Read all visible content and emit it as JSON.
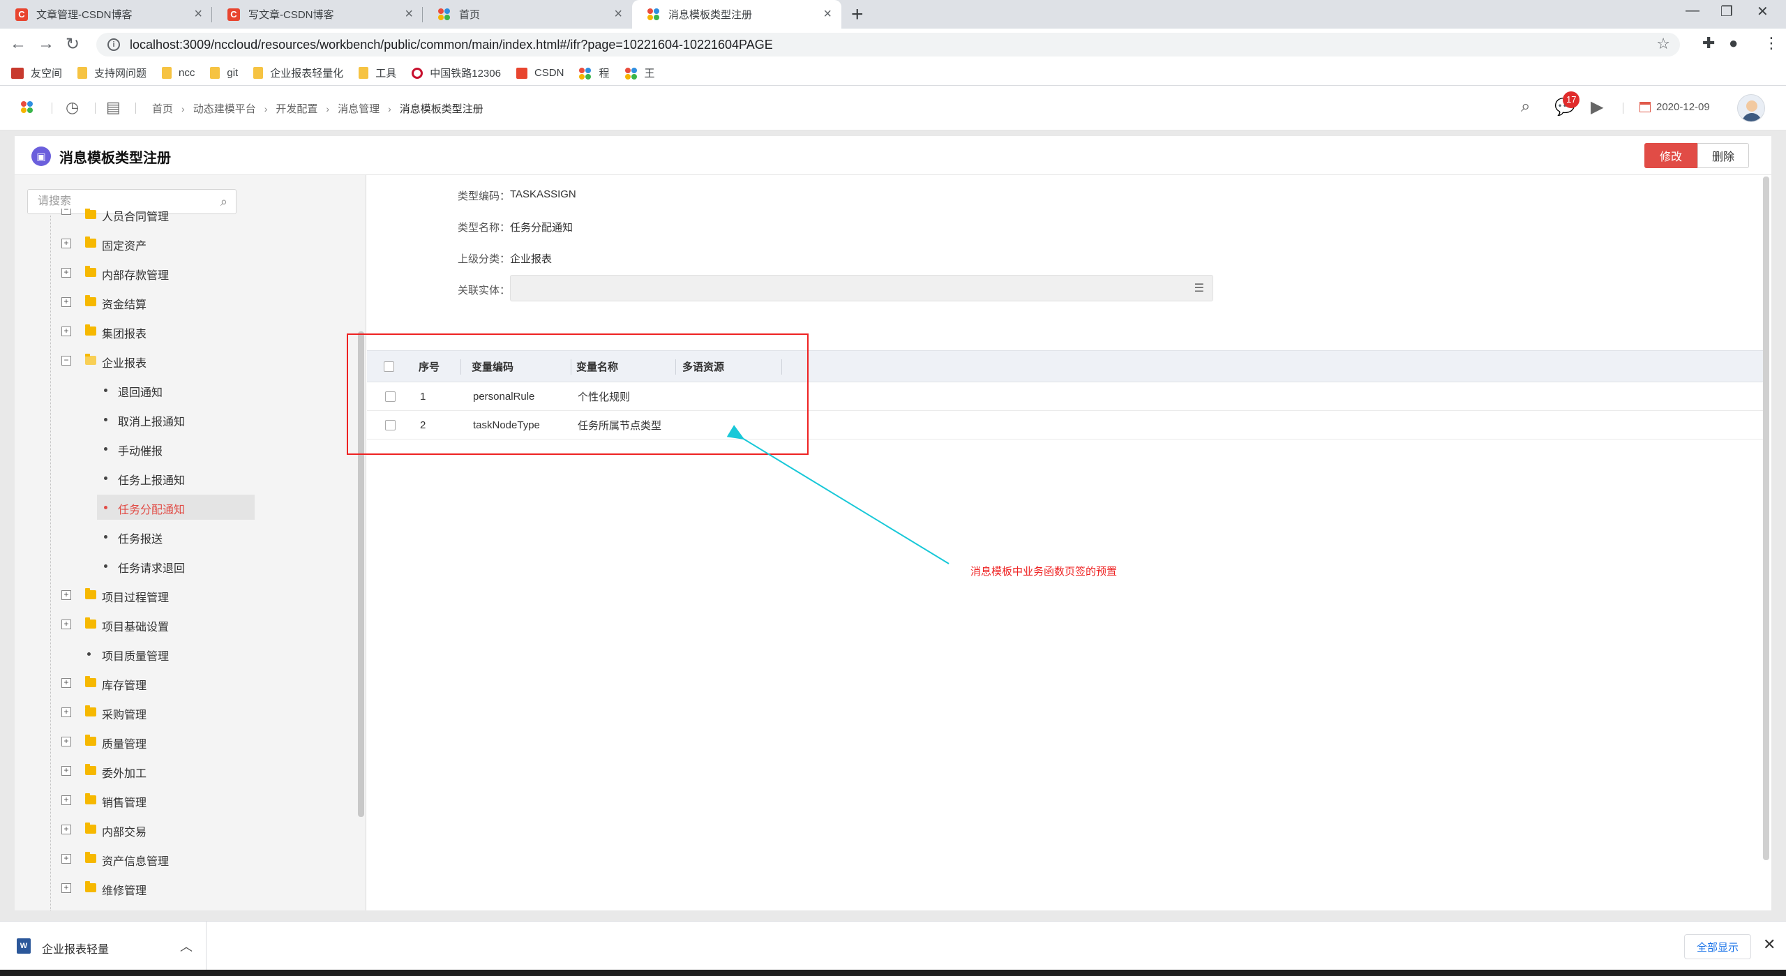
{
  "browser": {
    "tabs": [
      {
        "label": "文章管理-CSDN博客",
        "icon": "csdn-icon",
        "active": false
      },
      {
        "label": "写文章-CSDN博客",
        "icon": "csdn-icon",
        "active": false
      },
      {
        "label": "首页",
        "icon": "nc-icon",
        "active": false
      },
      {
        "label": "消息模板类型注册",
        "icon": "nc-icon",
        "active": true
      }
    ],
    "url": "localhost:3009/nccloud/resources/workbench/public/common/main/index.html#/ifr?page=10221604-10221604PAGE",
    "bookmarks": [
      "友空间",
      "支持网问题",
      "ncc",
      "git",
      "企业报表轻量化",
      "工具",
      "中国铁路12306",
      "CSDN",
      "程",
      "王"
    ]
  },
  "app": {
    "breadcrumbs": [
      "首页",
      "动态建模平台",
      "开发配置",
      "消息管理",
      "消息模板类型注册"
    ],
    "notification_count": "17",
    "date": "2020-12-09"
  },
  "page": {
    "title": "消息模板类型注册",
    "edit_label": "修改",
    "delete_label": "删除"
  },
  "tree": {
    "search_placeholder": "请搜索",
    "partial_top": "人员合同管理",
    "nodes": [
      {
        "label": "固定资产",
        "kind": "folder"
      },
      {
        "label": "内部存款管理",
        "kind": "folder"
      },
      {
        "label": "资金结算",
        "kind": "folder"
      },
      {
        "label": "集团报表",
        "kind": "folder"
      },
      {
        "label": "企业报表",
        "kind": "folder-open"
      },
      {
        "label": "退回通知",
        "kind": "child"
      },
      {
        "label": "取消上报通知",
        "kind": "child"
      },
      {
        "label": "手动催报",
        "kind": "child"
      },
      {
        "label": "任务上报通知",
        "kind": "child"
      },
      {
        "label": "任务分配通知",
        "kind": "child-selected"
      },
      {
        "label": "任务报送",
        "kind": "child"
      },
      {
        "label": "任务请求退回",
        "kind": "child"
      },
      {
        "label": "项目过程管理",
        "kind": "folder"
      },
      {
        "label": "项目基础设置",
        "kind": "folder"
      },
      {
        "label": "项目质量管理",
        "kind": "leaf"
      },
      {
        "label": "库存管理",
        "kind": "folder"
      },
      {
        "label": "采购管理",
        "kind": "folder"
      },
      {
        "label": "质量管理",
        "kind": "folder"
      },
      {
        "label": "委外加工",
        "kind": "folder"
      },
      {
        "label": "销售管理",
        "kind": "folder"
      },
      {
        "label": "内部交易",
        "kind": "folder"
      },
      {
        "label": "资产信息管理",
        "kind": "folder"
      },
      {
        "label": "维修管理",
        "kind": "folder"
      }
    ]
  },
  "form": {
    "type_code_label": "类型编码：",
    "type_code": "TASKASSIGN",
    "type_name_label": "类型名称：",
    "type_name": "任务分配通知",
    "parent_label": "上级分类：",
    "parent": "企业报表",
    "entity_label": "关联实体："
  },
  "grid": {
    "headers": {
      "seq": "序号",
      "code": "变量编码",
      "name": "变量名称",
      "lang": "多语资源"
    },
    "rows": [
      {
        "seq": "1",
        "code": "personalRule",
        "name": "个性化规则"
      },
      {
        "seq": "2",
        "code": "taskNodeType",
        "name": "任务所属节点类型"
      }
    ]
  },
  "annotation": {
    "text": "消息模板中业务函数页签的预置",
    "color": "#ee2222"
  },
  "downloads": {
    "file_name": "企业报表轻量",
    "show_all_label": "全部显示"
  }
}
